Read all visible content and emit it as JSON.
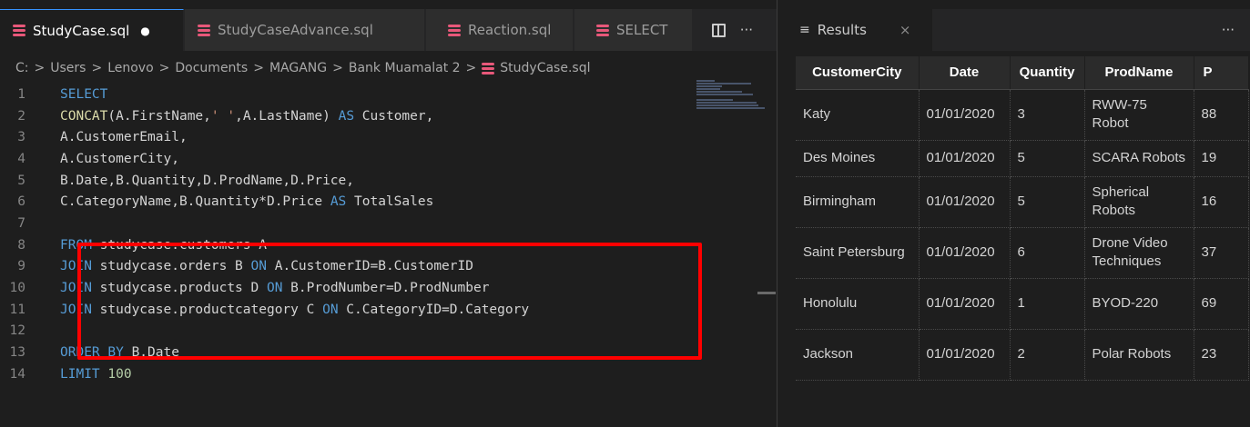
{
  "editor": {
    "tabs": [
      {
        "label": "StudyCase.sql",
        "dirty": "●"
      },
      {
        "label": "StudyCaseAdvance.sql"
      },
      {
        "label": "Reaction.sql"
      },
      {
        "label": "SELECT"
      }
    ],
    "more": "···",
    "breadcrumb": [
      "C:",
      "Users",
      "Lenovo",
      "Documents",
      "MAGANG",
      "Bank Muamalat 2",
      "StudyCase.sql"
    ],
    "breadcrumb_sep": ">",
    "line_numbers": [
      "1",
      "2",
      "3",
      "4",
      "5",
      "6",
      "7",
      "8",
      "9",
      "10",
      "11",
      "12",
      "13",
      "14"
    ],
    "code": {
      "l1": {
        "kw": "SELECT"
      },
      "l2": {
        "fn": "CONCAT",
        "a": "(A.FirstName,",
        "str": "' '",
        "b": ",A.LastName)",
        "kw": " AS ",
        "c": "Customer,"
      },
      "l3": "A.CustomerEmail,",
      "l4": "A.CustomerCity,",
      "l5": "B.Date,B.Quantity,D.ProdName,D.Price,",
      "l6": {
        "a": "C.CategoryName,B.Quantity*D.Price",
        "kw": " AS ",
        "b": "TotalSales"
      },
      "l8": {
        "kw": "FROM",
        "a": " studycase.customers A"
      },
      "l9": {
        "kw": "JOIN",
        "a": " studycase.orders B ",
        "kw2": "ON",
        "b": " A.CustomerID=B.CustomerID"
      },
      "l10": {
        "kw": "JOIN",
        "a": " studycase.products D ",
        "kw2": "ON",
        "b": " B.ProdNumber=D.ProdNumber"
      },
      "l11": {
        "kw": "JOIN",
        "a": " studycase.productcategory C ",
        "kw2": "ON",
        "b": " C.CategoryID=D.Category"
      },
      "l13": {
        "kw": "ORDER BY",
        "a": " B.Date"
      },
      "l14": {
        "kw": "LIMIT",
        "a": " 100"
      }
    }
  },
  "results": {
    "tab_label": "Results",
    "tab_close": "×",
    "more": "···",
    "columns": [
      "CustomerCity",
      "Date",
      "Quantity",
      "ProdName",
      "P"
    ],
    "rows": [
      {
        "city": "Katy",
        "date": "01/01/2020",
        "qty": "3",
        "prod": "RWW-75 Robot",
        "price": "88"
      },
      {
        "city": "Des Moines",
        "date": "01/01/2020",
        "qty": "5",
        "prod": "SCARA Robots",
        "price": "19"
      },
      {
        "city": "Birmingham",
        "date": "01/01/2020",
        "qty": "5",
        "prod": "Spherical Robots",
        "price": "16"
      },
      {
        "city": "Saint Petersburg",
        "date": "01/01/2020",
        "qty": "6",
        "prod": "Drone Video Techniques",
        "price": "37"
      },
      {
        "city": "Honolulu",
        "date": "01/01/2020",
        "qty": "1",
        "prod": "BYOD-220",
        "price": "69"
      },
      {
        "city": "Jackson",
        "date": "01/01/2020",
        "qty": "2",
        "prod": "Polar Robots",
        "price": "23"
      }
    ]
  },
  "colors": {
    "accent": "#3794ff",
    "highlight": "#ff0000",
    "db_icon": "#e8587a"
  }
}
